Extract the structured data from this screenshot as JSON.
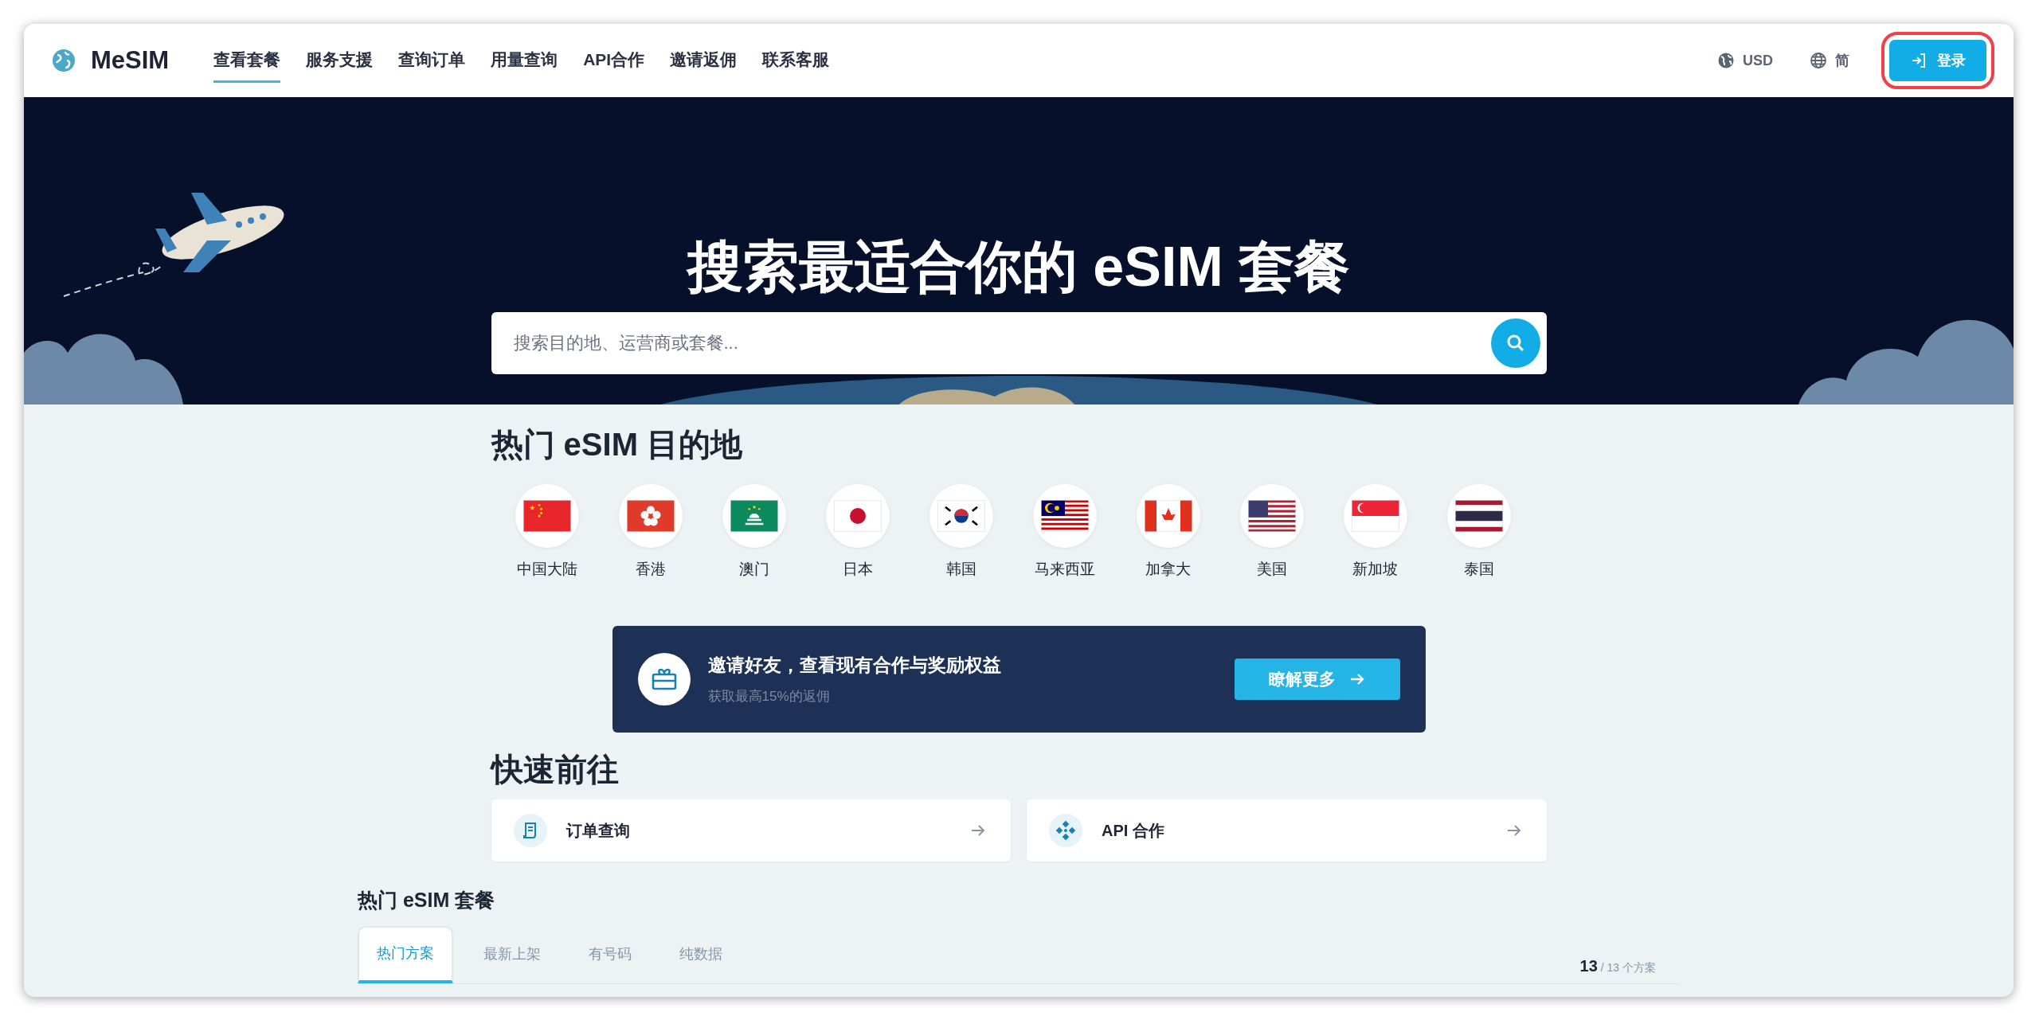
{
  "brand": {
    "name": "MeSIM"
  },
  "nav": [
    {
      "label": "查看套餐",
      "selected": true
    },
    {
      "label": "服务支援",
      "selected": false
    },
    {
      "label": "查询订单",
      "selected": false
    },
    {
      "label": "用量查询",
      "selected": false
    },
    {
      "label": "API合作",
      "selected": false
    },
    {
      "label": "邀请返佣",
      "selected": false
    },
    {
      "label": "联系客服",
      "selected": false
    }
  ],
  "currency": "USD",
  "language": "简",
  "login": {
    "label": "登录",
    "highlighted": true
  },
  "hero": {
    "title": "搜索最适合你的 eSIM 套餐",
    "search": {
      "placeholder": "搜索目的地、运营商或套餐..."
    }
  },
  "destinations": {
    "title": "热门 eSIM 目的地",
    "items": [
      {
        "name": "中国大陆",
        "kind": "cn"
      },
      {
        "name": "香港",
        "kind": "hk"
      },
      {
        "name": "澳门",
        "kind": "mo"
      },
      {
        "name": "日本",
        "kind": "jp"
      },
      {
        "name": "韩国",
        "kind": "kr"
      },
      {
        "name": "马来西亚",
        "kind": "my"
      },
      {
        "name": "加拿大",
        "kind": "ca"
      },
      {
        "name": "美国",
        "kind": "us"
      },
      {
        "name": "新加坡",
        "kind": "sg"
      },
      {
        "name": "泰国",
        "kind": "th"
      }
    ]
  },
  "invite": {
    "title": "邀请好友，查看现有合作与奖励权益",
    "subtitle": "获取最高15%的返佣",
    "button": "瞭解更多"
  },
  "quick": {
    "title": "快速前往",
    "items": [
      {
        "label": "订单查询",
        "kind": "orders"
      },
      {
        "label": "API 合作",
        "kind": "api"
      }
    ]
  },
  "plans": {
    "title": "热门 eSIM 套餐",
    "tabs": [
      {
        "label": "热门方案",
        "selected": true
      },
      {
        "label": "最新上架",
        "selected": false
      },
      {
        "label": "有号码",
        "selected": false
      },
      {
        "label": "纯数据",
        "selected": false
      }
    ],
    "count": "13",
    "count_total": "/ 13 个方案"
  }
}
